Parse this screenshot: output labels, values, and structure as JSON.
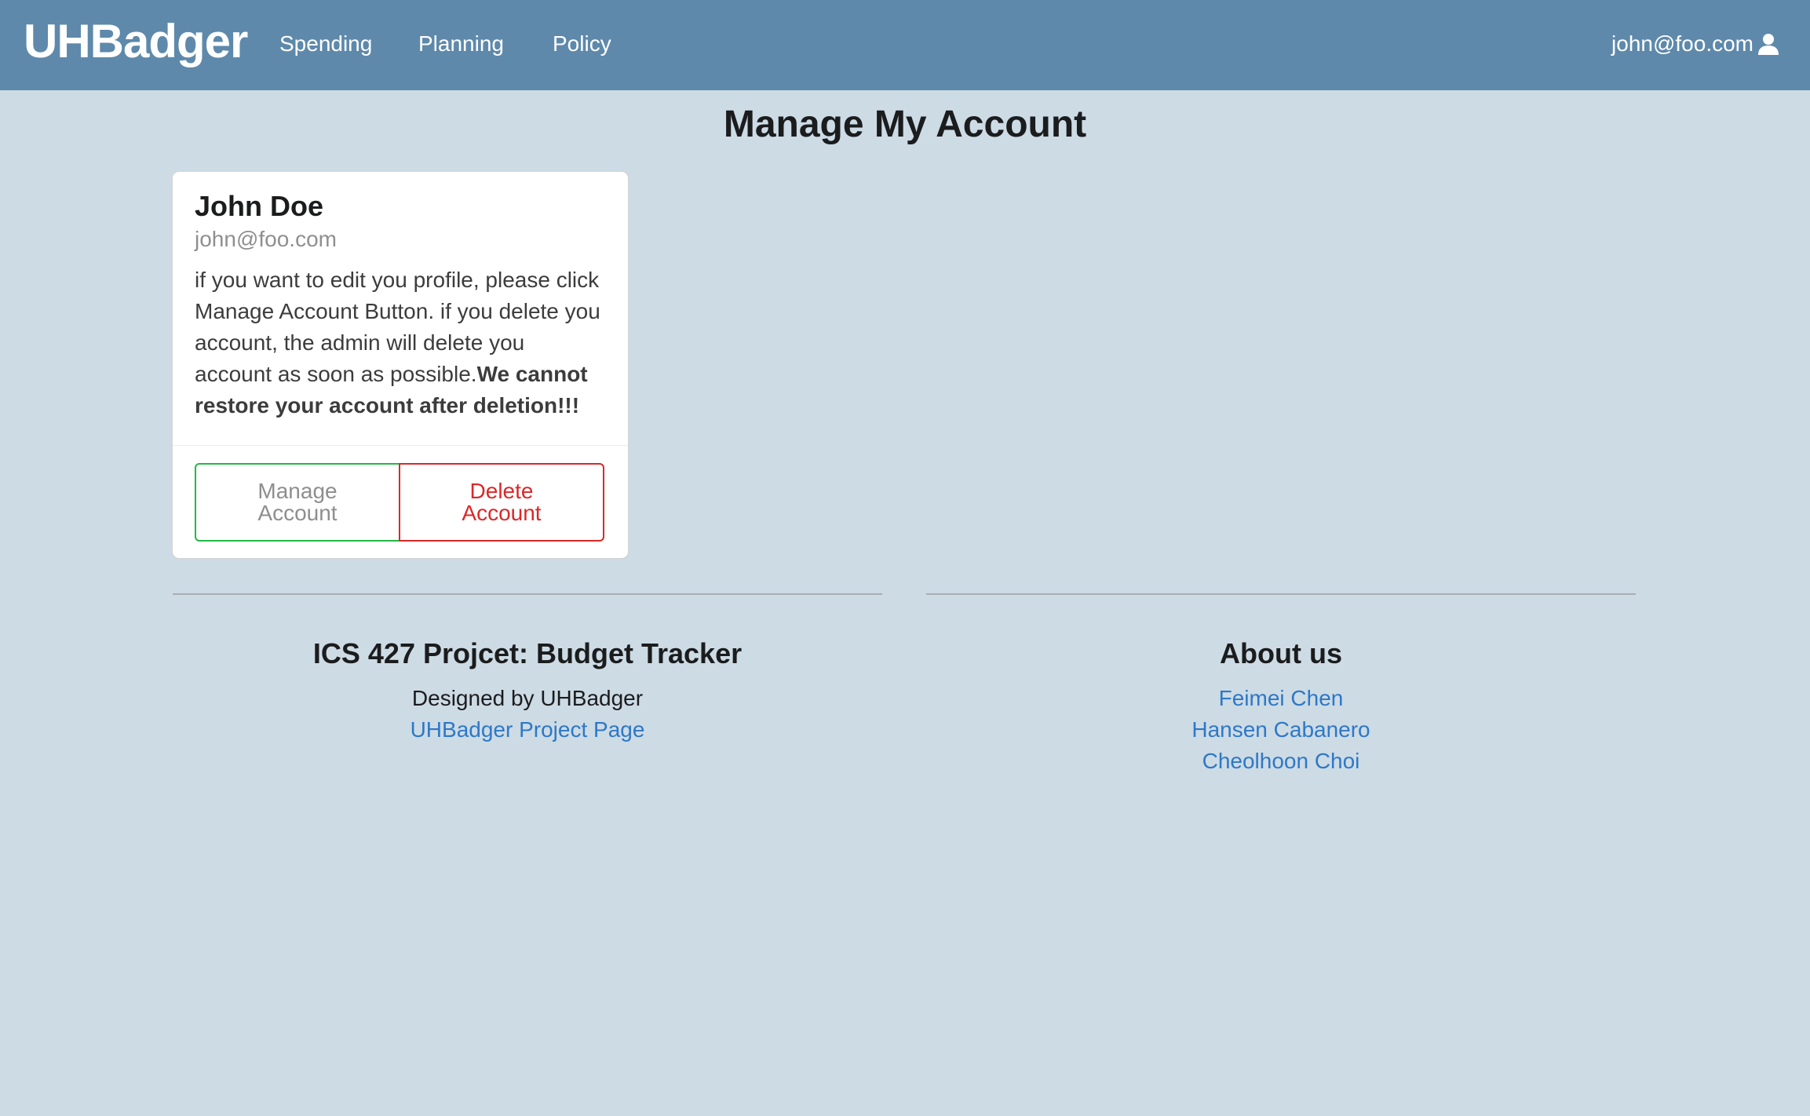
{
  "navbar": {
    "brand": "UHBadger",
    "items": [
      {
        "label": "Spending"
      },
      {
        "label": "Planning"
      },
      {
        "label": "Policy"
      }
    ],
    "user_email": "john@foo.com",
    "user_icon": "user-icon"
  },
  "page": {
    "title": "Manage My Account"
  },
  "account_card": {
    "name": "John Doe",
    "email": "john@foo.com",
    "description": "if you want to edit you profile, please click Manage Account Button. if you delete you account, the admin will delete you account as soon as possible.",
    "warning": "We cannot restore your account after deletion!!!",
    "manage_button_label": "Manage Account",
    "delete_button_label": "Delete Account"
  },
  "footer": {
    "left": {
      "heading": "ICS 427 Projcet: Budget Tracker",
      "designed_by": "Designed by UHBadger",
      "project_link": "UHBadger Project Page"
    },
    "right": {
      "heading": "About us",
      "members": [
        "Feimei Chen",
        "Hansen Cabanero",
        "Cheolhoon Choi"
      ]
    }
  },
  "colors": {
    "navbar_bg": "#5e89ab",
    "page_bg": "#cddbe5",
    "manage_border": "#21ba45",
    "delete_accent": "#db2828",
    "link": "#2e78c6"
  }
}
